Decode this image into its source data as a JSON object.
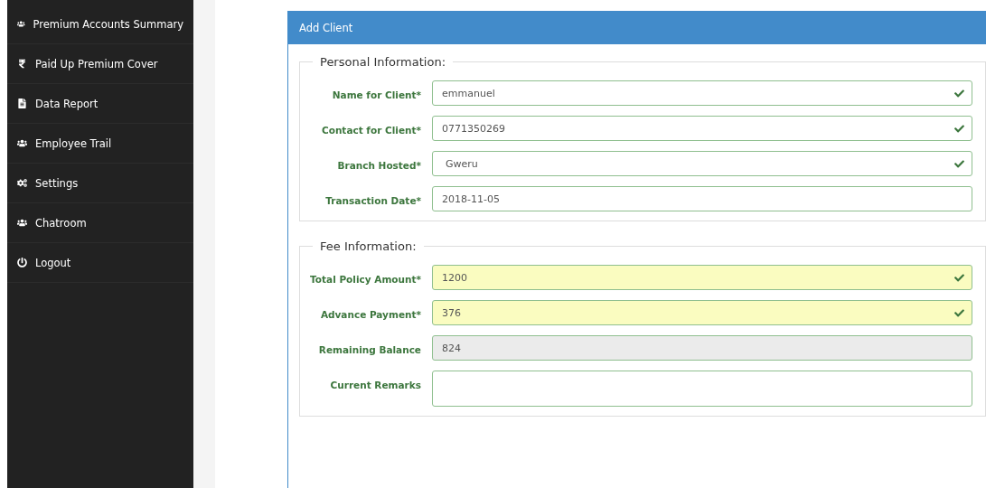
{
  "sidebar": {
    "items": [
      {
        "label": "Premium Accounts Summary"
      },
      {
        "label": "Paid Up Premium Cover"
      },
      {
        "label": "Data Report"
      },
      {
        "label": "Employee Trail"
      },
      {
        "label": "Settings"
      },
      {
        "label": "Chatroom"
      },
      {
        "label": "Logout"
      }
    ]
  },
  "panel": {
    "title": "Add Client",
    "sections": [
      {
        "legend": "Personal Information:",
        "fields": [
          {
            "label": "Name for Client*",
            "kind": "text",
            "value": "emmanuel",
            "valid": true,
            "autofilled": false,
            "disabled": false
          },
          {
            "label": "Contact for Client*",
            "kind": "text",
            "value": "0771350269",
            "valid": true,
            "autofilled": false,
            "disabled": false
          },
          {
            "label": "Branch Hosted*",
            "kind": "select",
            "value": "Gweru",
            "valid": true,
            "autofilled": false,
            "disabled": false
          },
          {
            "label": "Transaction Date*",
            "kind": "text",
            "value": "2018-11-05",
            "valid": false,
            "autofilled": false,
            "disabled": false
          }
        ]
      },
      {
        "legend": "Fee Information:",
        "fields": [
          {
            "label": "Total Policy Amount*",
            "kind": "text",
            "value": "1200",
            "valid": true,
            "autofilled": true,
            "disabled": false
          },
          {
            "label": "Advance Payment*",
            "kind": "text",
            "value": "376",
            "valid": true,
            "autofilled": true,
            "disabled": false
          },
          {
            "label": "Remaining Balance",
            "kind": "text",
            "value": "824",
            "valid": false,
            "autofilled": false,
            "disabled": true
          },
          {
            "label": "Current Remarks",
            "kind": "textarea",
            "valid": false,
            "autofilled": false,
            "disabled": false
          }
        ]
      }
    ]
  }
}
